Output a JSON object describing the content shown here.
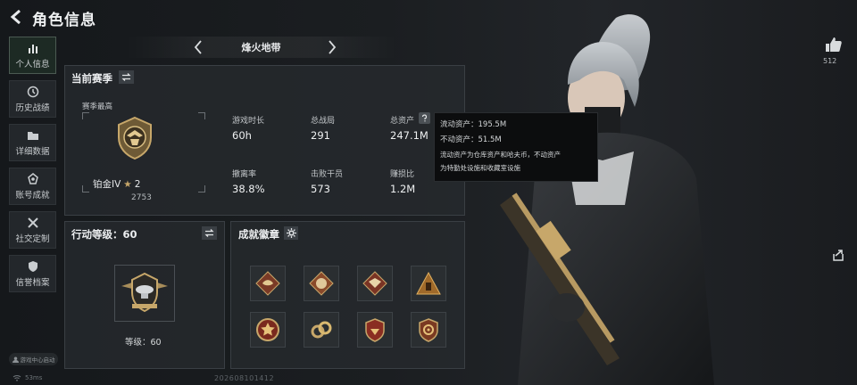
{
  "header": {
    "title": "角色信息"
  },
  "sidebar": {
    "items": [
      {
        "label": "个人信息",
        "icon": "bar-chart-icon",
        "active": true
      },
      {
        "label": "历史战绩",
        "icon": "clock-icon",
        "active": false
      },
      {
        "label": "详细数据",
        "icon": "folder-icon",
        "active": false
      },
      {
        "label": "账号成就",
        "icon": "medal-icon",
        "active": false
      },
      {
        "label": "社交定制",
        "icon": "tools-icon",
        "active": false
      },
      {
        "label": "信誉档案",
        "icon": "shield-icon",
        "active": false
      }
    ],
    "footer_label": "游戏中心启动"
  },
  "status": {
    "latency": "53ms",
    "uid": "202608101412"
  },
  "mode": {
    "name": "烽火地带"
  },
  "season": {
    "title": "当前赛季",
    "best_label": "赛季最高",
    "rank_name": "铂金IV",
    "rank_stars": "2",
    "rank_score": "2753",
    "stats": [
      {
        "label": "游戏时长",
        "value": "60h"
      },
      {
        "label": "总战局",
        "value": "291"
      },
      {
        "label": "总资产",
        "value": "247.1M"
      },
      {
        "label": "撤离率",
        "value": "38.8%"
      },
      {
        "label": "击败干员",
        "value": "573"
      },
      {
        "label": "赚损比",
        "value": "1.2M"
      }
    ]
  },
  "tooltip": {
    "liquid": "流动资产：195.5M",
    "fixed": "不动资产：51.5M",
    "note_line1": "流动资产为仓库资产和哈夫币，不动资产",
    "note_line2": "为特勤处设施和收藏室设施"
  },
  "action_level": {
    "title": "行动等级：60",
    "level_label": "等级：60"
  },
  "achievements": {
    "title": "成就徽章",
    "badges": [
      "dragon-emblem-icon",
      "beast-emblem-icon",
      "eagle-emblem-icon",
      "tower-emblem-icon",
      "star-medal-icon",
      "chain-medal-icon",
      "wing-shield-icon",
      "target-shield-icon"
    ]
  },
  "likes": {
    "count": "512"
  },
  "colors": {
    "accent": "#c7a76a",
    "panel": "#262a2e",
    "active_tab": "#1d2a24"
  }
}
